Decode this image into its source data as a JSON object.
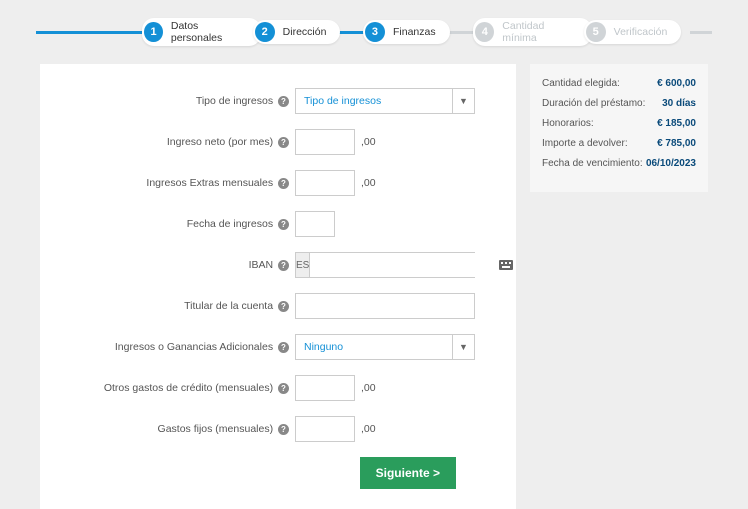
{
  "stepper": {
    "steps": [
      {
        "num": "1",
        "label": "Datos personales",
        "active": true
      },
      {
        "num": "2",
        "label": "Dirección",
        "active": true
      },
      {
        "num": "3",
        "label": "Finanzas",
        "active": true
      },
      {
        "num": "4",
        "label": "Cantidad mínima",
        "active": false
      },
      {
        "num": "5",
        "label": "Verificación",
        "active": false
      }
    ]
  },
  "form": {
    "income_type": {
      "label": "Tipo de ingresos",
      "placeholder": "Tipo de ingresos"
    },
    "net_income": {
      "label": "Ingreso neto (por mes)",
      "suffix": ",00"
    },
    "extra_income": {
      "label": "Ingresos Extras mensuales",
      "suffix": ",00"
    },
    "income_date": {
      "label": "Fecha de ingresos"
    },
    "iban": {
      "label": "IBAN",
      "prefix": "ES"
    },
    "account_holder": {
      "label": "Titular de la cuenta"
    },
    "additional_income": {
      "label": "Ingresos o Ganancias Adicionales",
      "value": "Ninguno"
    },
    "other_credit": {
      "label": "Otros gastos de crédito (mensuales)",
      "suffix": ",00"
    },
    "fixed_expenses": {
      "label": "Gastos fijos (mensuales)",
      "suffix": ",00"
    },
    "next_button": "Siguiente >"
  },
  "summary": {
    "rows": [
      {
        "label": "Cantidad elegida:",
        "value": "€  600,00"
      },
      {
        "label": "Duración del préstamo:",
        "value": "30 días"
      },
      {
        "label": "Honorarios:",
        "value": "€  185,00"
      },
      {
        "label": "Importe a devolver:",
        "value": "€  785,00"
      },
      {
        "label": "Fecha de vencimiento:",
        "value": "06/10/2023"
      }
    ]
  }
}
